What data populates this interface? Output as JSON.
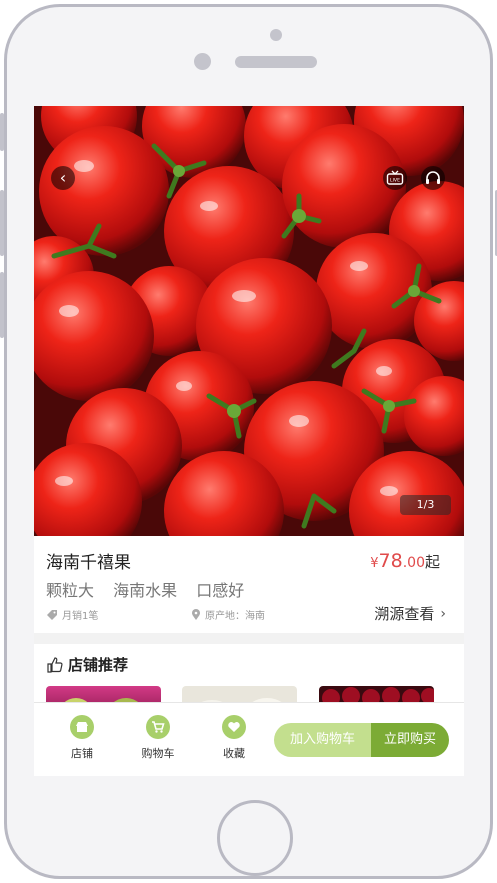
{
  "product": {
    "name": "海南千禧果",
    "price_currency": "¥",
    "price_integer": "78",
    "price_decimal": ".00",
    "price_suffix": "起",
    "tags": [
      "颗粒大",
      "海南水果",
      "口感好"
    ],
    "monthly_sales": "月销1笔",
    "origin": "原产地：海南",
    "trace_label": "溯源查看"
  },
  "gallery": {
    "pager": "1/3",
    "live_label": "LIVE"
  },
  "recommend": {
    "title": "店铺推荐"
  },
  "action_bar": {
    "store_label": "店铺",
    "cart_label": "购物车",
    "favorite_label": "收藏",
    "add_to_cart_label": "加入购物车",
    "buy_now_label": "立即购买"
  },
  "colors": {
    "accent_green": "#7cab35",
    "light_green": "#c3df8e",
    "price_red": "#e04a4a"
  }
}
